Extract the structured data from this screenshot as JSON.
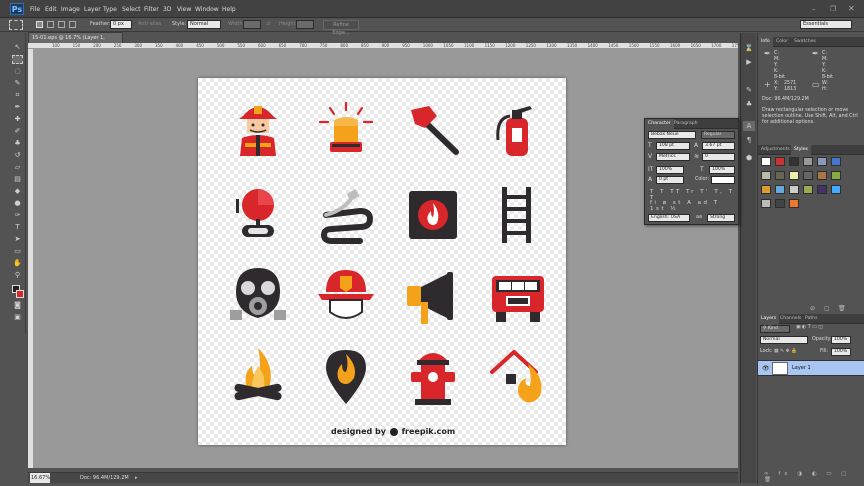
{
  "app": {
    "logo": "Ps"
  },
  "menu": [
    "File",
    "Edit",
    "Image",
    "Layer",
    "Type",
    "Select",
    "Filter",
    "3D",
    "View",
    "Window",
    "Help"
  ],
  "options": {
    "feather_label": "Feather:",
    "feather_value": "0 px",
    "antialias_label": "Anti-alias",
    "style_label": "Style:",
    "style_value": "Normal",
    "width_label": "Width:",
    "height_label": "Height:",
    "refine_label": "Refine Edge...",
    "workspace": "Essentials"
  },
  "document": {
    "tab_title": "15-01.eps @ 16.7% (Layer 1, CMYK/8)",
    "credit_prefix": "designed by",
    "credit_brand": "freepik.com"
  },
  "ruler_ticks": [
    "100",
    "150",
    "200",
    "250",
    "300",
    "350",
    "400",
    "450",
    "500",
    "550",
    "600",
    "650",
    "700",
    "750",
    "800",
    "850",
    "900",
    "950",
    "1000",
    "1050",
    "1100",
    "1150",
    "1200",
    "1250",
    "1300",
    "1350",
    "1400",
    "1450",
    "1500",
    "1550",
    "1600",
    "1650",
    "1700",
    "1750"
  ],
  "status": {
    "zoom": "16.67%",
    "doc": "Doc: 96.4M/129.2M"
  },
  "info_panel": {
    "tabs": [
      "Info",
      "Color",
      "Swatches"
    ],
    "c": "C:",
    "m": "M:",
    "y": "Y:",
    "k": "K:",
    "bits": "8-bit",
    "x_label": "X:",
    "x_value": "2571",
    "y_label": "Y:",
    "y_value": "1813",
    "w_label": "W:",
    "h_label": "H:",
    "doc": "Doc: 96.4M/129.2M",
    "help": "Draw rectangular selection or move selection outline. Use Shift, Alt, and Ctrl for additional options."
  },
  "adjust_panel": {
    "tabs": [
      "Adjustments",
      "Styles"
    ]
  },
  "character_panel": {
    "tabs": [
      "Character",
      "Paragraph"
    ],
    "font": "Bebas Neue",
    "style": "Regular",
    "size": "108 pt",
    "leading": "3.67 pt",
    "kerning": "Metrics",
    "tracking": "0",
    "vscale": "100%",
    "hscale": "100%",
    "baseline": "0 pt",
    "color_label": "Color:",
    "glyphs": [
      "T",
      "T",
      "TT",
      "Tr",
      "T'",
      "T,",
      "T",
      "T"
    ],
    "glyphs2": [
      "fi",
      "ø",
      "st",
      "A",
      "ad",
      "T",
      "1st",
      "½"
    ],
    "language": "English: USA",
    "aa_label": "aa",
    "aa_value": "Strong"
  },
  "layers_panel": {
    "tabs": [
      "Layers",
      "Channels",
      "Paths"
    ],
    "kind": "Kind",
    "blend": "Normal",
    "opacity_label": "Opacity:",
    "opacity": "100%",
    "lock_label": "Lock:",
    "fill_label": "Fill:",
    "fill": "100%",
    "layer_name": "Layer 1"
  },
  "colors": {
    "red": "#d8262a",
    "dark": "#2f2a2e",
    "orange": "#f4a21a",
    "skin": "#f6c9a0",
    "gray": "#d9d9d9"
  }
}
